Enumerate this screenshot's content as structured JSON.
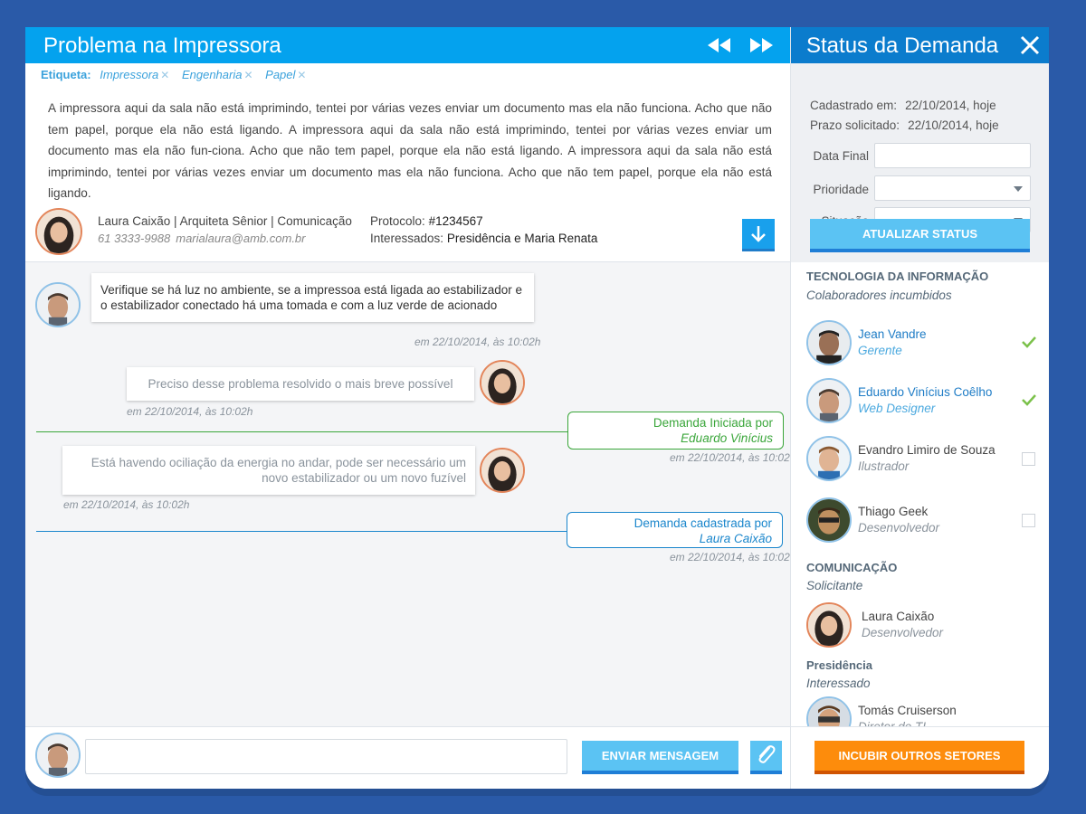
{
  "demand": {
    "title": "Problema na Impressora",
    "tags_label": "Etiqueta:",
    "tags": [
      "Impressora",
      "Engenharia",
      "Papel"
    ],
    "description": "A impressora aqui da sala não está imprimindo, tentei por várias vezes enviar um documento mas ela não funciona. Acho que não tem papel, porque ela não está ligando. A impressora aqui da sala não está imprimindo, tentei por várias vezes enviar um documento mas ela não fun-ciona. Acho que não tem papel, porque ela não está ligando. A impressora aqui da sala não está imprimindo, tentei por várias vezes enviar um documento mas ela não funciona. Acho que não tem papel, porque ela não está ligando.",
    "author": {
      "name_line": "Laura Caixão | Arquiteta Sênior | Comunicação",
      "phone": "61 3333-9988",
      "email": "marialaura@amb.com.br"
    },
    "protocol_label": "Protocolo:",
    "protocol_value": "#1234567",
    "interested_label": "Interessados:",
    "interested_value": "Presidência e Maria Renata"
  },
  "chat": {
    "messages": [
      {
        "text": "Verifique se há luz no ambiente, se a impressoa está ligada ao estabilizador e o estabilizador conectado há uma tomada e com a luz verde de acionado",
        "timestamp": "em 22/10/2014, às 10:02h"
      },
      {
        "text": "Preciso desse problema resolvido o mais breve possível",
        "timestamp": "em 22/10/2014, às 10:02h"
      },
      {
        "text": "Está havendo ociliação da energia no andar, pode ser necessário um novo estabilizador ou um novo fuzível",
        "timestamp": "em 22/10/2014, às 10:02h"
      }
    ],
    "events": [
      {
        "text": "Demanda Iniciada por",
        "who": "Eduardo Vinícius",
        "timestamp": "em 22/10/2014, às 10:02h",
        "color": "#3aa63a"
      },
      {
        "text": "Demanda cadastrada por",
        "who": "Laura Caixão",
        "timestamp": "em 22/10/2014, às 10:02h",
        "color": "#1a86cc"
      }
    ]
  },
  "composer": {
    "placeholder": "",
    "send_label": "ENVIAR MENSAGEM"
  },
  "status": {
    "title": "Status da Demanda",
    "registered_label": "Cadastrado em:",
    "registered_value": "22/10/2014, hoje",
    "requested_label": "Prazo solicitado:",
    "requested_value": "22/10/2014, hoje",
    "final_date_label": "Data Final",
    "priority_label": "Prioridade",
    "situation_label": "Situação",
    "update_label": "ATUALIZAR STATUS"
  },
  "teams": {
    "ti": {
      "title": "TECNOLOGIA DA INFORMAÇÃO",
      "subtitle": "Colaboradores incumbidos",
      "members": [
        {
          "name": "Jean Vandre",
          "role": "Gerente",
          "checked": true
        },
        {
          "name": "Eduardo Vinícius Coêlho",
          "role": "Web Designer",
          "checked": true
        },
        {
          "name": "Evandro Limiro de Souza",
          "role": "Ilustrador",
          "checked": false
        },
        {
          "name": "Thiago Geek",
          "role": "Desenvolvedor",
          "checked": false
        }
      ]
    },
    "comunicacao": {
      "title": "COMUNICAÇÃO",
      "subtitle": "Solicitante",
      "members": [
        {
          "name": "Laura Caixão",
          "role": "Desenvolvedor"
        }
      ]
    },
    "presidencia": {
      "title": "Presidência",
      "subtitle": "Interessado",
      "members": [
        {
          "name": "Tomás Cruiserson",
          "role": "Diretor de TI"
        }
      ]
    }
  },
  "incubir_label": "INCUBIR OUTROS SETORES",
  "colors": {
    "title_bar": "#04a2ee",
    "status_bar": "#0b7ccd",
    "page_background": "#2a5aa8",
    "accent_orange": "#fd8c0c",
    "accent_green": "#3aa63a"
  },
  "icons": [
    "rewind-icon",
    "fast-forward-icon",
    "download-arrow-icon",
    "close-icon",
    "paperclip-icon",
    "check-icon",
    "caret-down-icon",
    "tag-remove-icon"
  ]
}
